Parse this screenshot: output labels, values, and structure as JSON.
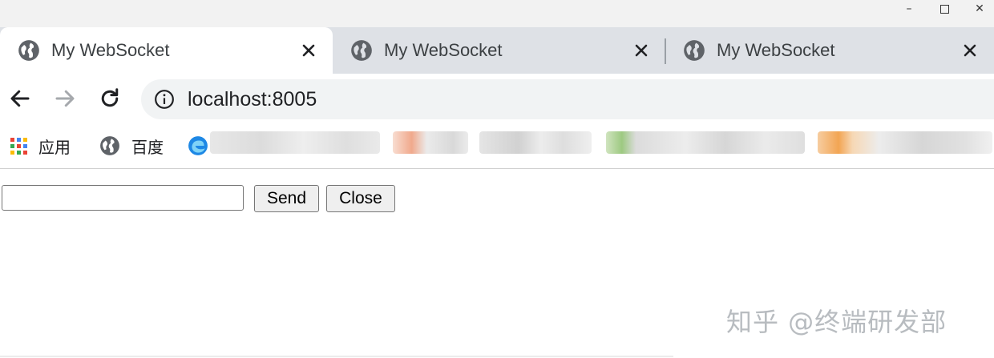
{
  "window": {
    "minimize_glyph": "–",
    "close_glyph": "✕"
  },
  "tabs": [
    {
      "title": "My WebSocket",
      "icon": "globe-icon",
      "active": true
    },
    {
      "title": "My WebSocket",
      "icon": "globe-icon",
      "active": false
    },
    {
      "title": "My WebSocket",
      "icon": "globe-icon",
      "active": false
    }
  ],
  "toolbar": {
    "url": "localhost:8005"
  },
  "bookmarks": [
    {
      "label": "应用",
      "icon": "apps-grid-icon"
    },
    {
      "label": "百度",
      "icon": "globe-icon"
    },
    {
      "label": "",
      "icon": "edge-icon"
    }
  ],
  "page": {
    "input_value": "",
    "send_label": "Send",
    "close_label": "Close"
  },
  "watermark": "知乎 @终端研发部",
  "colors": {
    "tabstrip_bg": "#dee1e6",
    "omnibox_bg": "#f1f3f4",
    "button_bg": "#efefef"
  }
}
